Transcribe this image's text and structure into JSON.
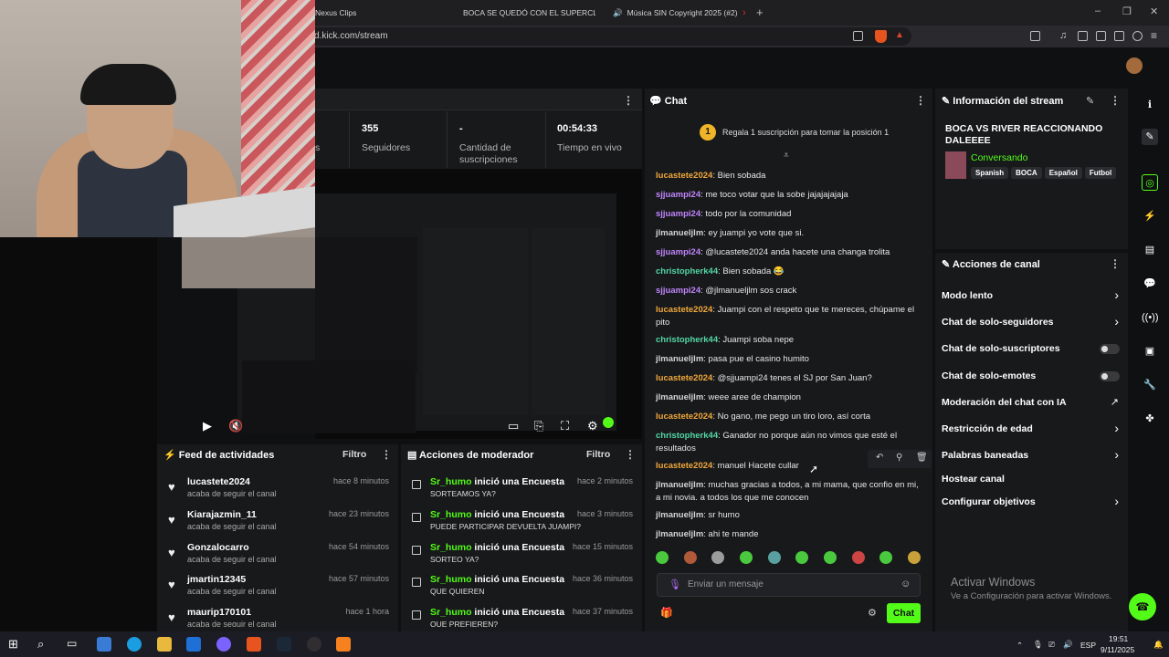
{
  "browser": {
    "tabs": [
      {
        "label": "Nexus Clips"
      },
      {
        "label": "BOCA SE QUEDÓ CON EL SUPERCLÁ"
      },
      {
        "label": "Música SIN Copyright 2025 (#2)"
      }
    ],
    "url": "d.kick.com/stream",
    "new_tab": "+",
    "win_min": "–",
    "win_max": "❐",
    "win_close": "✕"
  },
  "stats": {
    "followers_value": "355",
    "followers_label": "Seguidores",
    "subs_value": "-",
    "subs_label": "Cantidad de suscripciones",
    "live_value": "00:54:33",
    "live_label": "Tiempo en vivo",
    "partial_label": "s"
  },
  "feed": {
    "title": "Feed de actividades",
    "filter": "Filtro",
    "items": [
      {
        "name": "lucastete2024",
        "sub": "acaba de seguir el canal",
        "time": "hace 8 minutos"
      },
      {
        "name": "Kiarajazmin_11",
        "sub": "acaba de seguir el canal",
        "time": "hace 23 minutos"
      },
      {
        "name": "Gonzalocarro",
        "sub": "acaba de seguir el canal",
        "time": "hace 54 minutos"
      },
      {
        "name": "jmartin12345",
        "sub": "acaba de seguir el canal",
        "time": "hace 57 minutos"
      },
      {
        "name": "maurip170101",
        "sub": "acaba de seguir el canal",
        "time": "hace 1 hora"
      }
    ]
  },
  "modactions": {
    "title": "Acciones de moderador",
    "filter": "Filtro",
    "items": [
      {
        "user": "Sr_humo",
        "action": " inició una Encuesta",
        "sub": "SORTEAMOS YA?",
        "time": "hace 2 minutos"
      },
      {
        "user": "Sr_humo",
        "action": " inició una Encuesta",
        "sub": "PUEDE PARTICIPAR DEVUELTA JUAMPI?",
        "time": "hace 3 minutos"
      },
      {
        "user": "Sr_humo",
        "action": " inició una Encuesta",
        "sub": "SORTEO YA?",
        "time": "hace 15 minutos"
      },
      {
        "user": "Sr_humo",
        "action": " inició una Encuesta",
        "sub": "QUE QUIEREN",
        "time": "hace 36 minutos"
      },
      {
        "user": "Sr_humo",
        "action": " inició una Encuesta",
        "sub": "QUE PREFIEREN?",
        "time": "hace 37 minutos"
      }
    ]
  },
  "chat": {
    "title": "Chat",
    "pinned_badge": "1",
    "pinned_text": "Regala 1 suscripción para tomar la posición 1",
    "messages": [
      {
        "user": "lucastete2024",
        "color": "orange",
        "text": ": Bien sobada"
      },
      {
        "user": "sjjuampi24",
        "color": "purple",
        "text": ": me toco votar que la sobe jajajajajaja"
      },
      {
        "user": "sjjuampi24",
        "color": "purple",
        "text": ": todo por la comunidad"
      },
      {
        "user": "jlmanueljlm",
        "color": "gray",
        "text": ": ey juampi yo vote que si."
      },
      {
        "user": "sjjuampi24",
        "color": "purple",
        "text": ": @lucastete2024 anda hacete una changa trolita"
      },
      {
        "user": "christopherk44",
        "color": "teal",
        "text": ": Bien sobada 😂"
      },
      {
        "user": "sjjuampi24",
        "color": "purple",
        "text": ": @jlmanueljlm sos crack"
      },
      {
        "user": "lucastete2024",
        "color": "orange",
        "text": ": Juampi con el respeto que te mereces, chúpame el pito"
      },
      {
        "user": "christopherk44",
        "color": "teal",
        "text": ": Juampi soba nepe"
      },
      {
        "user": "jlmanueljlm",
        "color": "gray",
        "text": ": pasa pue el casino humito"
      },
      {
        "user": "lucastete2024",
        "color": "orange",
        "text": ": @sjjuampi24 tenes el SJ por San Juan?"
      },
      {
        "user": "jlmanueljlm",
        "color": "gray",
        "text": ": weee aree de champion"
      },
      {
        "user": "lucastete2024",
        "color": "orange",
        "text": ": No gano, me pego un tiro loro, así corta"
      },
      {
        "user": "christopherk44",
        "color": "teal",
        "text": ": Ganador no porque aún no vimos que esté el resultados"
      },
      {
        "user": "lucastete2024",
        "color": "orange",
        "text": ": manuel Hacete cullar"
      },
      {
        "user": "jlmanueljlm",
        "color": "gray",
        "text": ": muchas gracias a todos, a mi mama, que confio en mi, a mi novia. a todos los que me conocen"
      },
      {
        "user": "jlmanueljlm",
        "color": "gray",
        "text": ": sr humo"
      },
      {
        "user": "jlmanueljlm",
        "color": "gray",
        "text": ": ahi te mande"
      }
    ],
    "input_placeholder": "Enviar un mensaje",
    "send_label": "Chat"
  },
  "info": {
    "title": "Información del stream",
    "stream_title": "BOCA VS RIVER REACCIONANDO DALEEEE",
    "category": "Conversando",
    "tags": [
      "Spanish",
      "BOCA",
      "Español",
      "Futbol"
    ]
  },
  "actions": {
    "title": "Acciones de canal",
    "items": [
      {
        "label": "Modo lento",
        "kind": "chevron"
      },
      {
        "label": "Chat de solo-seguidores",
        "kind": "chevron"
      },
      {
        "label": "Chat de solo-suscriptores",
        "kind": "toggle"
      },
      {
        "label": "Chat de solo-emotes",
        "kind": "toggle"
      },
      {
        "label": "Moderación del chat con IA",
        "kind": "link"
      },
      {
        "label": "Restricción de edad",
        "kind": "chevron"
      },
      {
        "label": "Palabras baneadas",
        "kind": "chevron"
      },
      {
        "label": "Hostear canal",
        "kind": "none"
      },
      {
        "label": "Configurar objetivos",
        "kind": "chevron"
      }
    ]
  },
  "watermark": {
    "line1": "Activar Windows",
    "line2": "Ve a Configuración para activar Windows."
  },
  "taskbar": {
    "lang": "ESP",
    "time": "19:51",
    "date": "9/11/2025"
  }
}
